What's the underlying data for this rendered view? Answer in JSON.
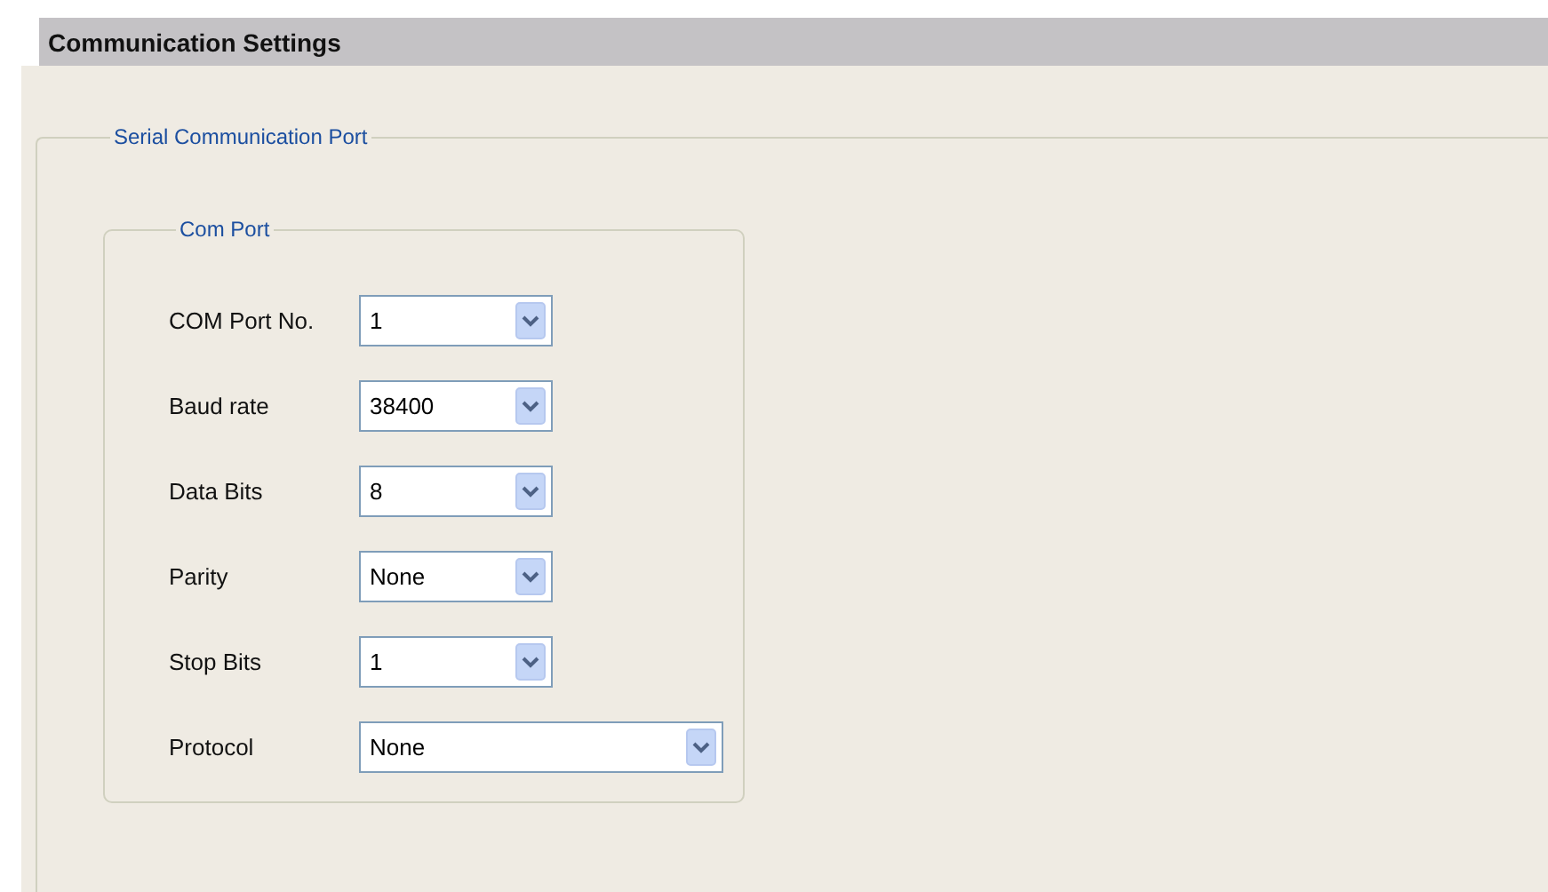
{
  "header": {
    "title": "Communication Settings"
  },
  "group": {
    "legend": "Serial Communication Port",
    "subgroup": {
      "legend": "Com Port",
      "fields": [
        {
          "label": "COM Port No.",
          "value": "1",
          "kind": "narrow"
        },
        {
          "label": "Baud rate",
          "value": "38400",
          "kind": "narrow"
        },
        {
          "label": "Data Bits",
          "value": "8",
          "kind": "narrow"
        },
        {
          "label": "Parity",
          "value": "None",
          "kind": "narrow"
        },
        {
          "label": "Stop Bits",
          "value": "1",
          "kind": "narrow"
        },
        {
          "label": "Protocol",
          "value": "None",
          "kind": "wide"
        }
      ]
    }
  }
}
